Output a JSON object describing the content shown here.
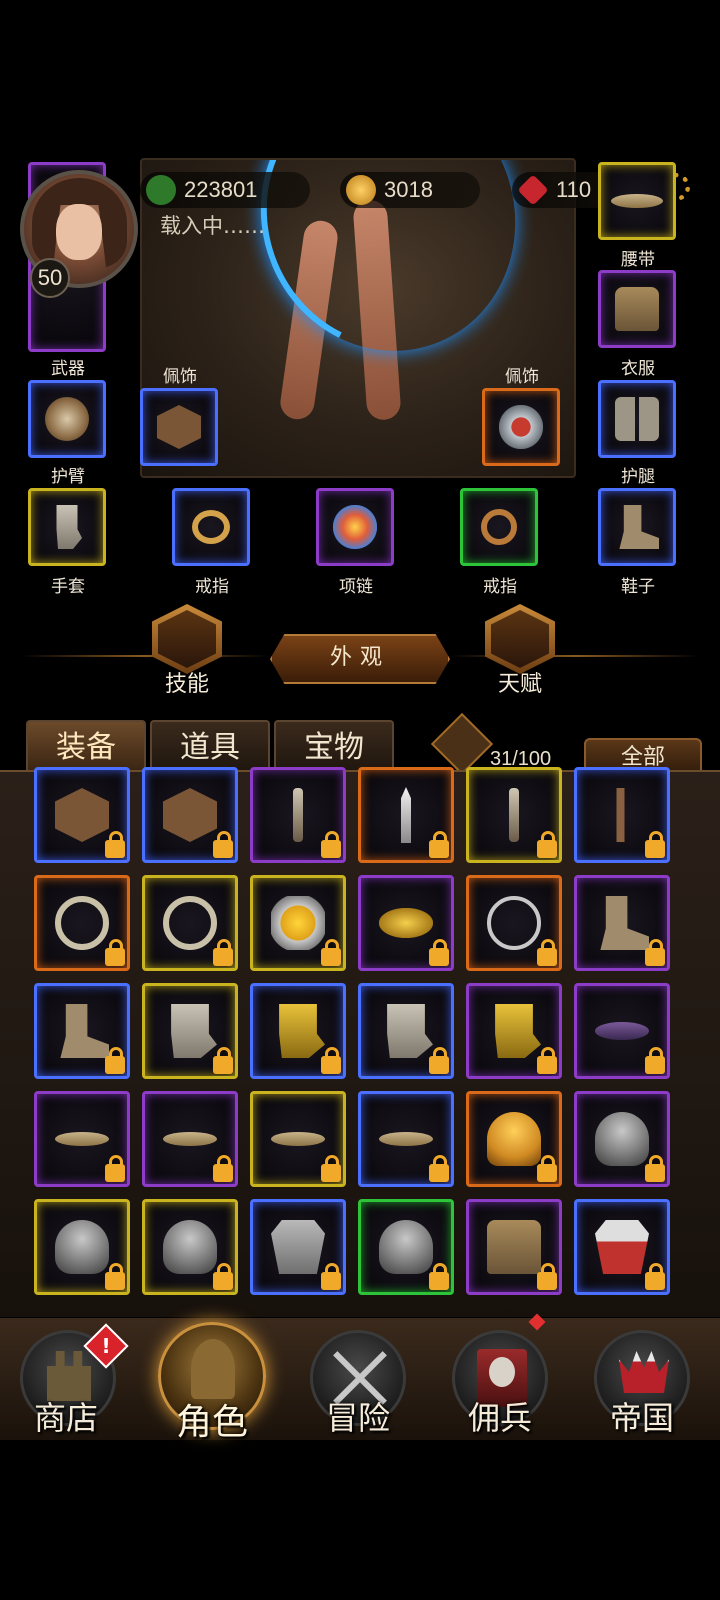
{
  "header": {
    "power": "223801",
    "gold": "3018",
    "gems": "110",
    "loading_text": "载入中……",
    "level": "50"
  },
  "equipment": {
    "weapon": "武器",
    "belt": "腰带",
    "clothes": "衣服",
    "accessory_left": "佩饰",
    "accessory_right": "佩饰",
    "armguard": "护臂",
    "legguard": "护腿",
    "gloves": "手套",
    "ring_left": "戒指",
    "necklace": "项链",
    "ring_right": "戒指",
    "shoes": "鞋子"
  },
  "actions": {
    "skills": "技能",
    "appearance": "外观",
    "talent": "天赋"
  },
  "inventory": {
    "tabs": [
      "装备",
      "道具",
      "宝物"
    ],
    "count": "31/100",
    "filter": "全部",
    "items": [
      {
        "icon": "badge-shield-icon",
        "rarity": "blue"
      },
      {
        "icon": "wolf-badge-icon",
        "rarity": "blue"
      },
      {
        "icon": "ornate-staff-icon",
        "rarity": "purple"
      },
      {
        "icon": "dagger-icon",
        "rarity": "orange"
      },
      {
        "icon": "mace-icon",
        "rarity": "yellow"
      },
      {
        "icon": "axe-icon",
        "rarity": "blue"
      },
      {
        "icon": "silver-ring-icon",
        "rarity": "orange"
      },
      {
        "icon": "silver-ring-icon",
        "rarity": "yellow"
      },
      {
        "icon": "yellow-gem-ring-icon",
        "rarity": "yellow"
      },
      {
        "icon": "winged-amulet-icon",
        "rarity": "purple"
      },
      {
        "icon": "tree-amulet-icon",
        "rarity": "orange"
      },
      {
        "icon": "boot-icon",
        "rarity": "purple"
      },
      {
        "icon": "boot-icon",
        "rarity": "blue"
      },
      {
        "icon": "gauntlet-icon",
        "rarity": "yellow"
      },
      {
        "icon": "gold-gauntlet-icon",
        "rarity": "blue"
      },
      {
        "icon": "gauntlet-icon",
        "rarity": "blue"
      },
      {
        "icon": "gold-greave-icon",
        "rarity": "purple"
      },
      {
        "icon": "skull-collar-icon",
        "rarity": "purple"
      },
      {
        "icon": "belt-icon",
        "rarity": "purple"
      },
      {
        "icon": "belt-icon",
        "rarity": "purple"
      },
      {
        "icon": "blue-belt-icon",
        "rarity": "yellow"
      },
      {
        "icon": "leather-belt-icon",
        "rarity": "blue"
      },
      {
        "icon": "gold-helmet-icon",
        "rarity": "orange"
      },
      {
        "icon": "crested-helmet-icon",
        "rarity": "purple"
      },
      {
        "icon": "steel-helmet-icon",
        "rarity": "yellow"
      },
      {
        "icon": "plumed-helmet-icon",
        "rarity": "yellow"
      },
      {
        "icon": "skull-armor-icon",
        "rarity": "blue"
      },
      {
        "icon": "steel-helmet-icon",
        "rarity": "green"
      },
      {
        "icon": "leather-armor-icon",
        "rarity": "purple"
      },
      {
        "icon": "red-cape-armor-icon",
        "rarity": "blue"
      }
    ]
  },
  "nav": {
    "shop": "商店",
    "character": "角色",
    "adventure": "冒险",
    "mercenary": "佣兵",
    "empire": "帝国",
    "shop_alert": "!"
  },
  "colors": {
    "blue": "#4b6fff",
    "purple": "#8d3cc7",
    "yellow": "#c9b41f",
    "orange": "#d96a1a",
    "green": "#2ec43a",
    "accent": "#c9913e"
  }
}
